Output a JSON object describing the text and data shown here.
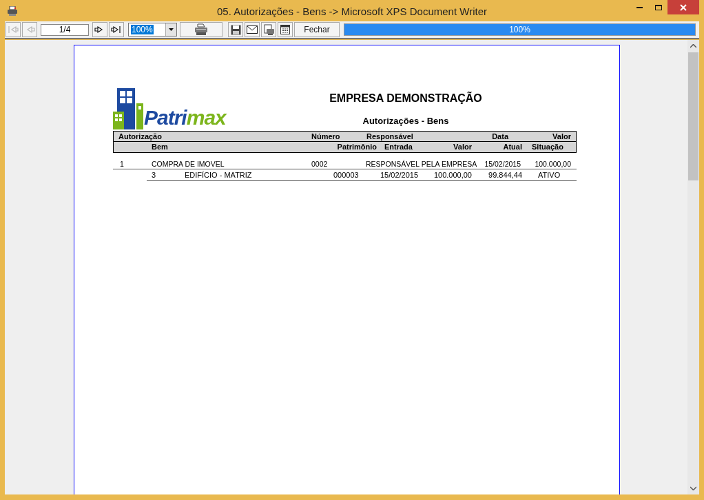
{
  "window": {
    "title": "05. Autorizações - Bens -> Microsoft XPS Document Writer"
  },
  "toolbar": {
    "nav_buttons": [
      {
        "kind": "first",
        "disabled": true
      },
      {
        "kind": "prev",
        "disabled": true
      }
    ],
    "page_field": {
      "value": "1/4"
    },
    "nav_buttons_2": [
      {
        "kind": "next",
        "disabled": false
      },
      {
        "kind": "last",
        "disabled": false
      }
    ],
    "zoom_combo": {
      "value": "100%"
    },
    "action_buttons": [
      {
        "kind": "print"
      },
      {
        "kind": "save"
      },
      {
        "kind": "email"
      },
      {
        "kind": "export"
      },
      {
        "kind": "grid"
      }
    ],
    "close_button": {
      "label": "Fechar"
    },
    "progress": {
      "level": 1,
      "reading": "100%"
    }
  },
  "report": {
    "logo_text": [
      {
        "text": "Patri",
        "color": "#1d4aa0"
      },
      {
        "text": "max",
        "color": "#7cb51c"
      }
    ],
    "title": "EMPRESA DEMONSTRAÇÃO",
    "subtitle": "Autorizações - Bens",
    "header_row_1": [
      "Autorização",
      "Número",
      "Responsável",
      "Data",
      "Valor"
    ],
    "header_row_2": [
      "Bem",
      "Patrimônio",
      "Entrada",
      "Valor",
      "Atual",
      "Situação"
    ],
    "rows": [
      {
        "cells": [
          "1",
          "COMPRA DE IMOVEL",
          "0002",
          "RESPONSÁVEL PELA EMPRESA",
          "15/02/2015",
          "100.000,00"
        ],
        "items": [
          {
            "cells": [
              "3",
              "EDIFÍCIO - MATRIZ",
              "000003",
              "15/02/2015",
              "100.000,00",
              "99.844,44",
              "ATIVO"
            ]
          }
        ]
      }
    ]
  }
}
